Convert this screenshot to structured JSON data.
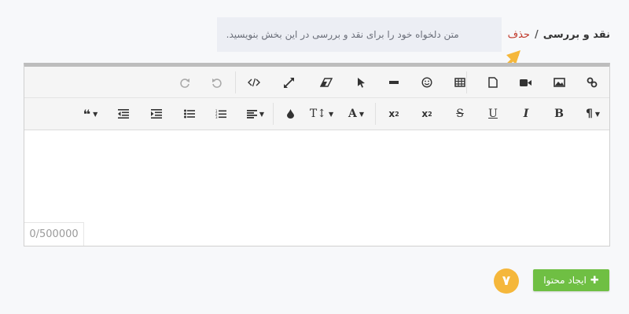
{
  "breadcrumb": {
    "section": "نقد و بررسی",
    "separator": "/",
    "delete": "حذف"
  },
  "hint": "متن دلخواه خود را برای نقد و بررسی در این بخش بنویسید.",
  "toolbar": {
    "row1": [
      {
        "name": "link-icon",
        "glyph": "🔗"
      },
      {
        "name": "image-icon",
        "glyph": "🖼"
      },
      {
        "name": "video-icon",
        "glyph": "■"
      },
      {
        "name": "file-icon",
        "glyph": "▢"
      },
      {
        "name": "table-icon",
        "glyph": "▦"
      },
      {
        "name": "emoji-icon",
        "glyph": "☺"
      },
      {
        "name": "horizontal-rule-icon",
        "glyph": "━"
      },
      {
        "name": "select-icon",
        "glyph": "➤"
      },
      {
        "name": "clear-format-icon",
        "glyph": "⌫"
      },
      {
        "name": "fullscreen-icon",
        "glyph": "⤢"
      },
      {
        "name": "code-view-icon",
        "glyph": "</>"
      },
      {
        "name": "undo-icon",
        "glyph": "↶"
      },
      {
        "name": "redo-icon",
        "glyph": "↷"
      }
    ],
    "row2": [
      {
        "name": "paragraph-icon",
        "glyph": "¶"
      },
      {
        "name": "bold-icon",
        "glyph": "B"
      },
      {
        "name": "italic-icon",
        "glyph": "I"
      },
      {
        "name": "underline-icon",
        "glyph": "U"
      },
      {
        "name": "strikethrough-icon",
        "glyph": "S"
      },
      {
        "name": "subscript-icon",
        "glyph": "x₂"
      },
      {
        "name": "superscript-icon",
        "glyph": "x²"
      },
      {
        "name": "font-color-icon",
        "glyph": "A"
      },
      {
        "name": "font-size-icon",
        "glyph": "T↕"
      },
      {
        "name": "color-drop-icon",
        "glyph": "●"
      },
      {
        "name": "align-icon",
        "glyph": "≡"
      },
      {
        "name": "ordered-list-icon",
        "glyph": "⒈"
      },
      {
        "name": "unordered-list-icon",
        "glyph": "•"
      },
      {
        "name": "indent-icon",
        "glyph": "⇥"
      },
      {
        "name": "outdent-icon",
        "glyph": "⇤"
      },
      {
        "name": "quote-icon",
        "glyph": "❝"
      }
    ]
  },
  "counter": "0/500000",
  "create_button": {
    "label": "ایجاد محتوا",
    "icon": "plus-icon"
  },
  "step_badge": "۷",
  "colors": {
    "accent_green": "#6fbf43",
    "badge_orange": "#f5b73b",
    "delete_red": "#c0392b",
    "arrow": "#f5b73b"
  }
}
